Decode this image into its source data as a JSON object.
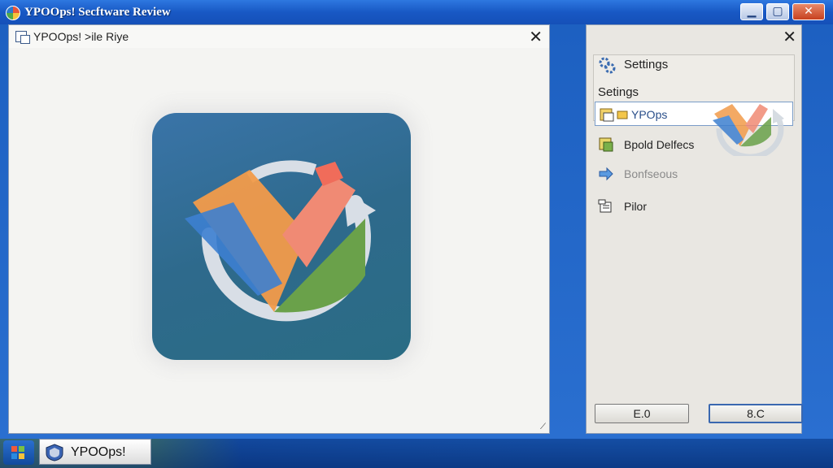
{
  "window": {
    "title": "YPOOps!  Secftware Review"
  },
  "document": {
    "title": "YPOOps! >ile Riye"
  },
  "settings": {
    "title": "Settings",
    "subtitle": "Setings",
    "items": [
      {
        "label": "YPOps",
        "icon": "folder-app-icon",
        "selected": true
      },
      {
        "label": "Bpold Delfecs",
        "icon": "folder-gear-icon"
      },
      {
        "label": "Bonfseous",
        "icon": "arrow-right-icon",
        "disabled": true
      },
      {
        "label": "Pilor",
        "icon": "printer-doc-icon"
      }
    ],
    "buttons": {
      "left": "E.0",
      "right": "8.C"
    }
  },
  "taskbar": {
    "task_label": "YPOOps!"
  }
}
